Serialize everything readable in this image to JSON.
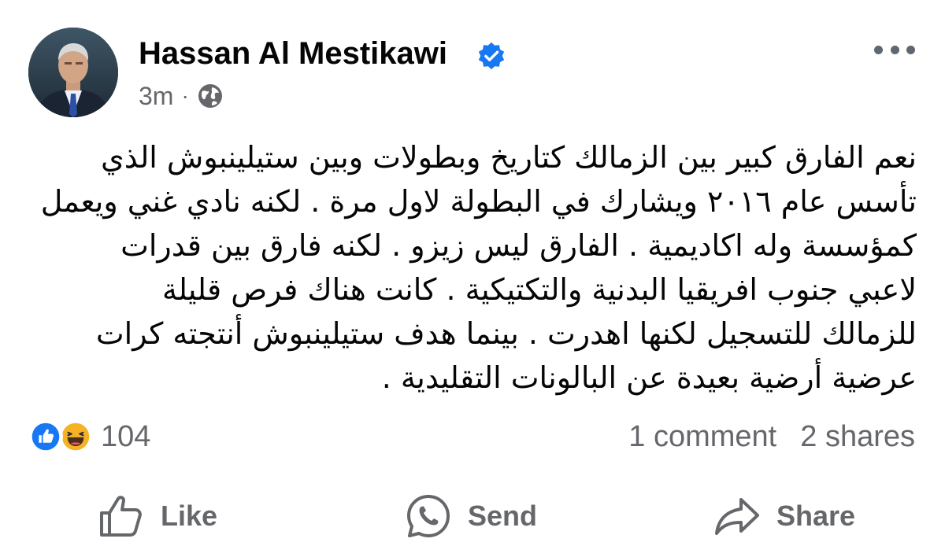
{
  "post": {
    "author": "Hassan Al Mestikawi",
    "time": "3m",
    "separator": "·",
    "text_lines": [
      "نعم الفارق كبير بين الزمالك كتاريخ وبطولات وبين ستيلينبوش الذي",
      "تأسس عام ٢٠١٦ ويشارك في البطولة لاول مرة . لكنه نادي غني ويعمل",
      "كمؤسسة وله اكاديمية . الفارق ليس زيزو . لكنه فارق بين قدرات",
      "لاعبي جنوب افريقيا البدنية والتكتيكية . كانت هناك فرص قليلة",
      "للزمالك للتسجيل لكنها اهدرت . بينما هدف ستيلينبوش أنتجته كرات",
      "عرضية أرضية بعيدة عن البالونات  التقليدية ."
    ],
    "reaction_count": "104",
    "comments": "1 comment",
    "shares": "2 shares"
  },
  "actions": {
    "like": "Like",
    "send": "Send",
    "share": "Share"
  },
  "icons": {
    "verified": "verified-badge-icon",
    "audience": "globe-icon",
    "more": "more-options-icon",
    "reaction_like": "like-reaction-icon",
    "reaction_haha": "haha-reaction-icon",
    "like": "thumbs-up-icon",
    "send": "whatsapp-icon",
    "share": "share-arrow-icon"
  },
  "colors": {
    "verified_blue": "#1877f2",
    "secondary_text": "#65676b",
    "primary_text": "#050505",
    "haha_yellow": "#f7b125"
  }
}
